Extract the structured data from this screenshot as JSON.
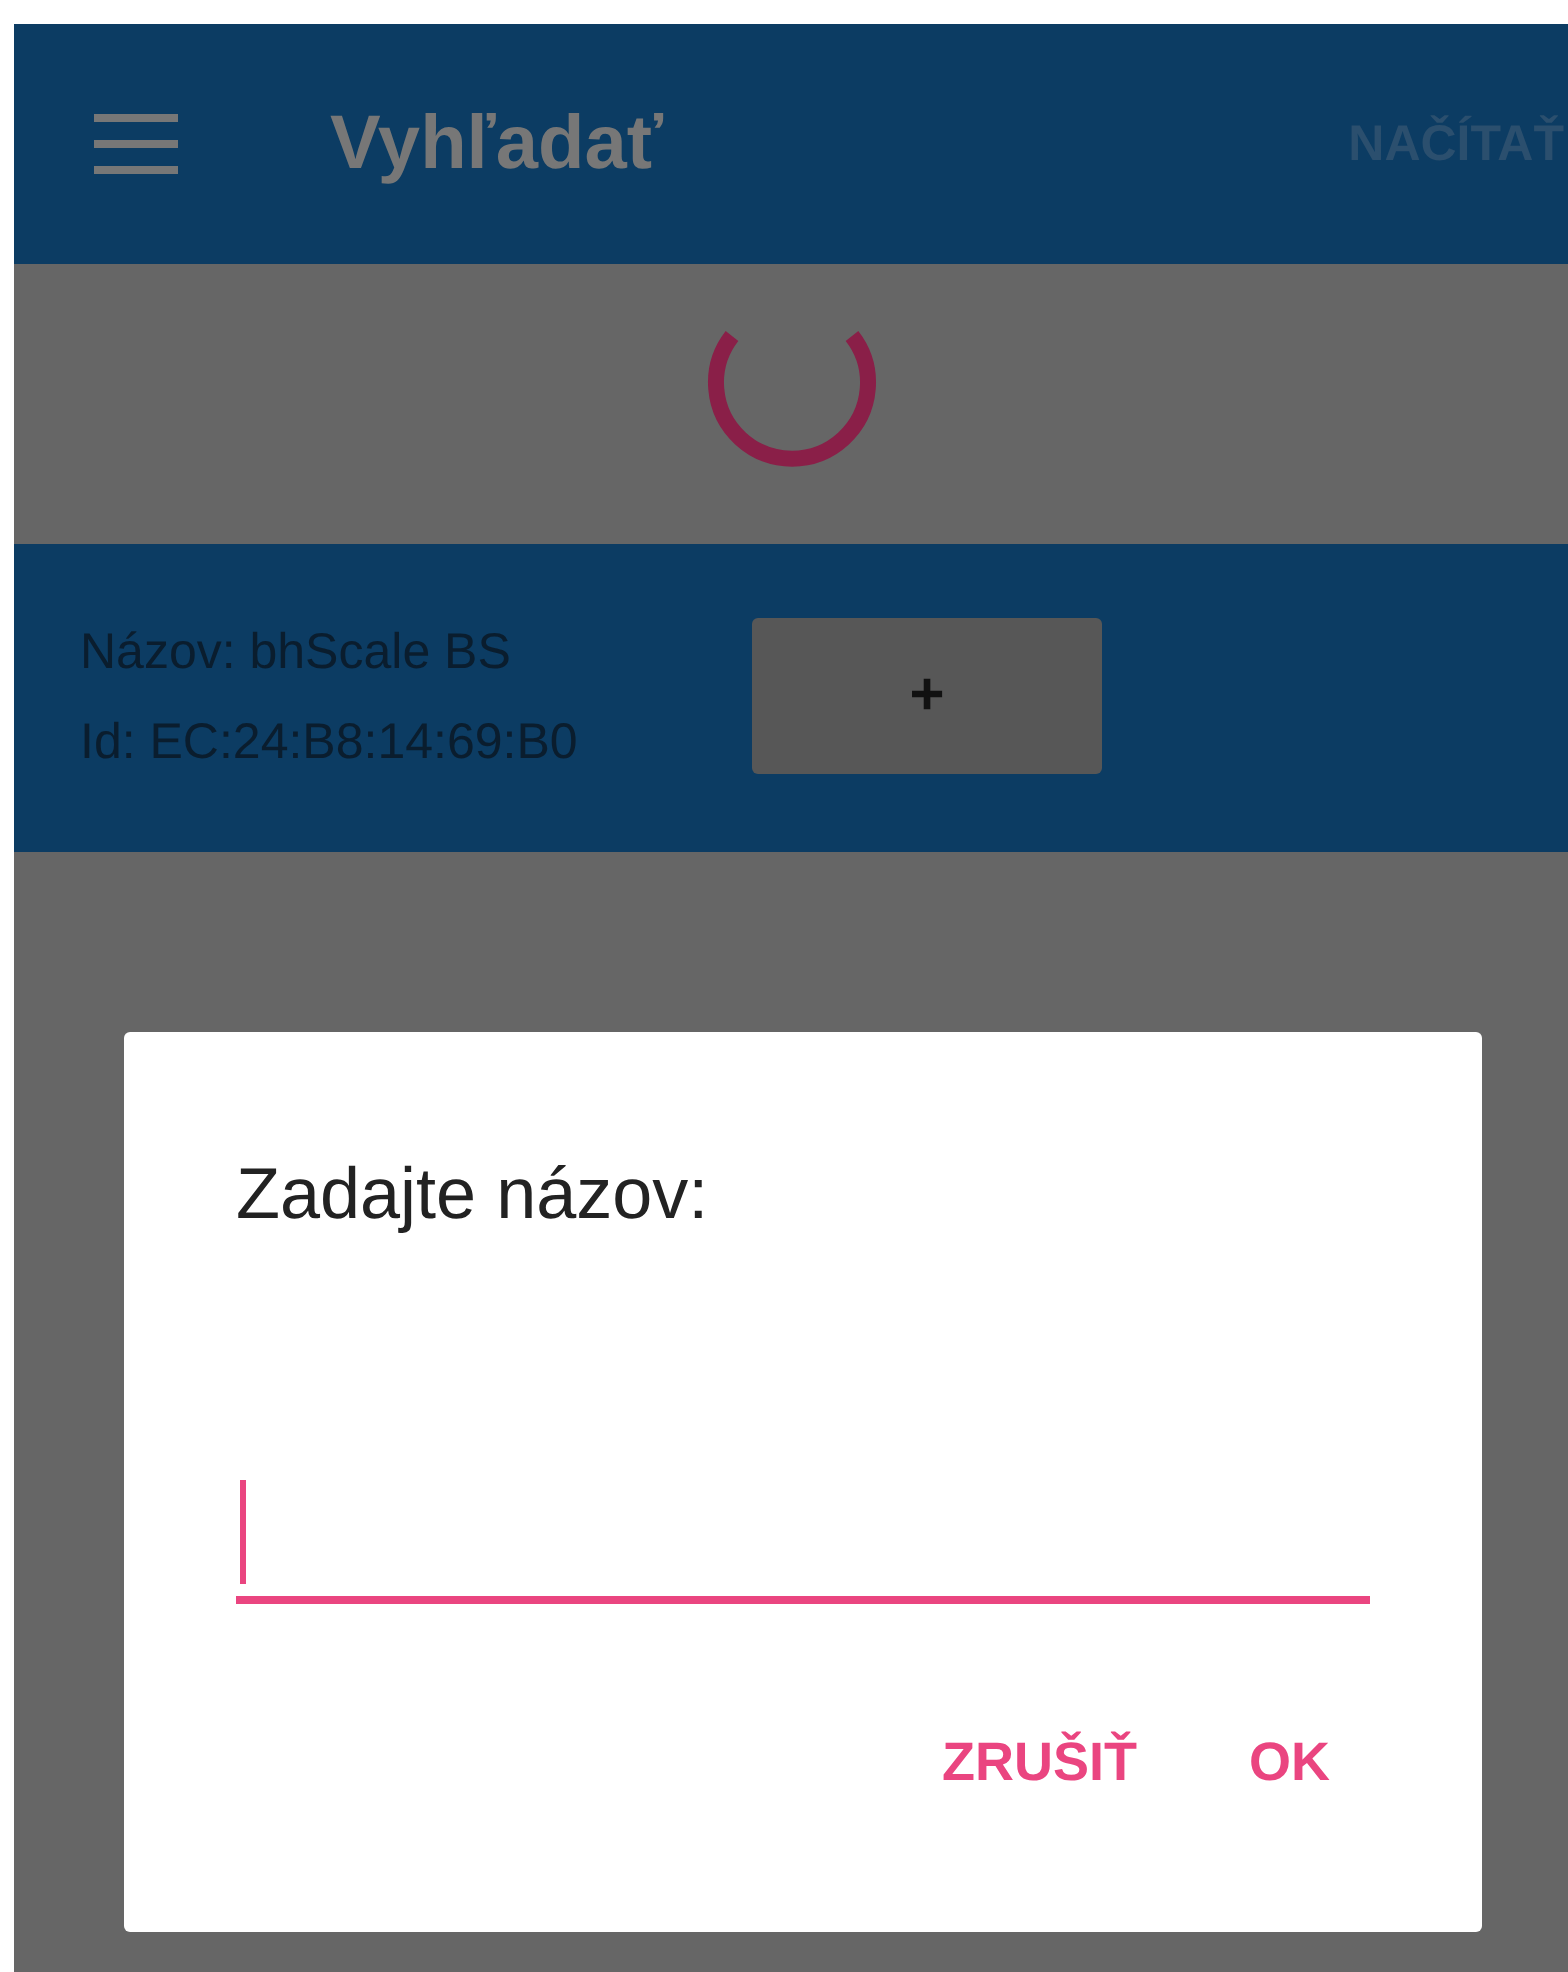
{
  "app_bar": {
    "title": "Vyhľadať",
    "action": "NAČÍTAŤ"
  },
  "devices": [
    {
      "name": "Názov: bhScale BS",
      "id": "Id: EC:24:B8:14:69:B0",
      "button": "+"
    }
  ],
  "dialog": {
    "title": "Zadajte názov:",
    "buttons": [
      "ZRUŠIŤ",
      "OK"
    ]
  }
}
